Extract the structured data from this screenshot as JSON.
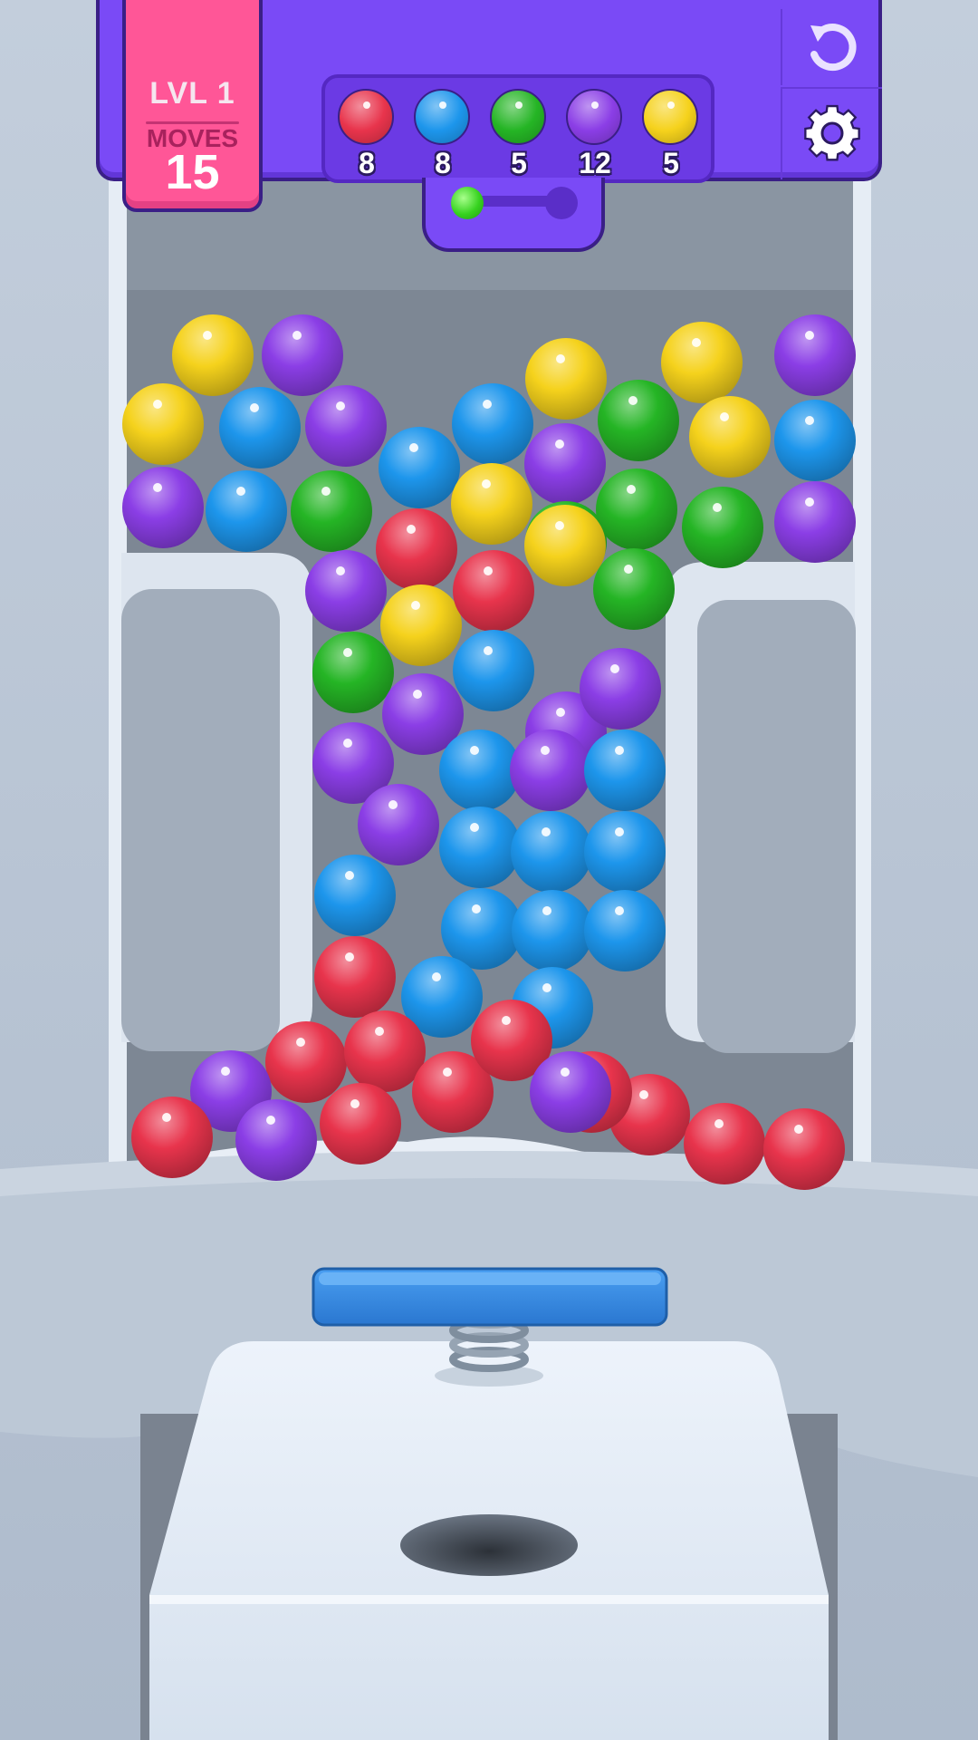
{
  "hud": {
    "level_label": "LVL 1",
    "moves_label": "MOVES",
    "moves_value": "15",
    "icons": {
      "undo": "undo-icon",
      "settings": "gear-icon"
    }
  },
  "goals": [
    {
      "color": "red",
      "count": "8"
    },
    {
      "color": "blue",
      "count": "8"
    },
    {
      "color": "green",
      "count": "5"
    },
    {
      "color": "purple",
      "count": "12"
    },
    {
      "color": "yellow",
      "count": "5"
    }
  ],
  "progress": {
    "value": 0
  },
  "colors": {
    "red": "#e8344c",
    "blue": "#1d96ec",
    "green": "#25b525",
    "purple": "#8b3ee6",
    "yellow": "#f5d21c",
    "hud_purple": "#7a4af6",
    "level_pink": "#ff5697"
  },
  "board": {
    "balls": [
      "yellow",
      "purple",
      "yellow",
      "yellow",
      "purple",
      "yellow",
      "blue",
      "purple",
      "blue",
      "green",
      "yellow",
      "blue",
      "purple",
      "blue",
      "green",
      "blue",
      "purple",
      "yellow",
      "green",
      "purple",
      "red",
      "green",
      "green",
      "purple",
      "yellow",
      "red",
      "yellow",
      "green",
      "green",
      "blue",
      "purple",
      "purple",
      "purple",
      "purple",
      "blue",
      "purple",
      "blue",
      "purple",
      "blue",
      "blue",
      "blue",
      "blue",
      "blue",
      "blue",
      "blue",
      "blue",
      "blue",
      "red",
      "red",
      "purple",
      "red",
      "red",
      "purple",
      "red",
      "red",
      "red",
      "red",
      "red",
      "red",
      "red",
      "purple"
    ]
  }
}
